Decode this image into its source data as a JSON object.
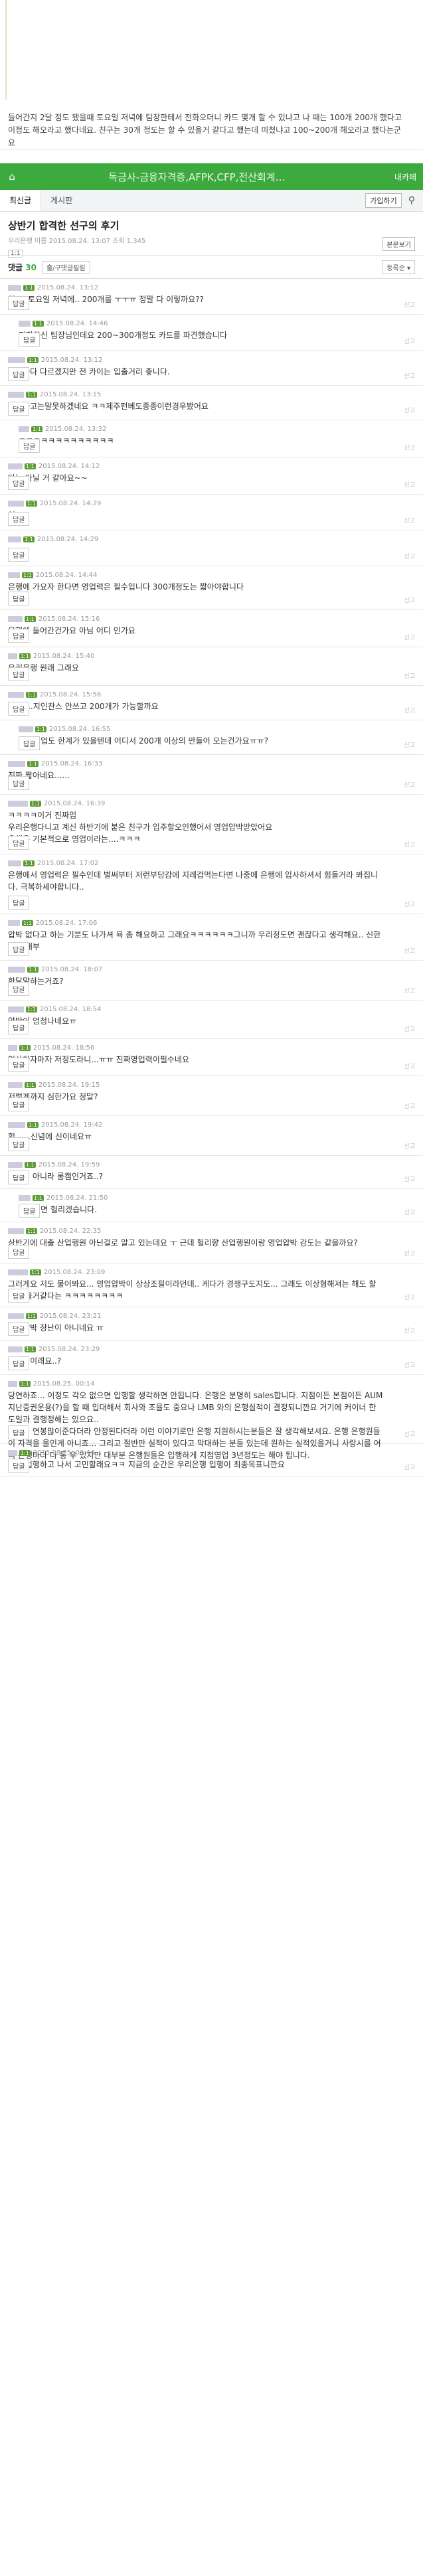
{
  "intro_text": "들어간지 2달 정도 됐을때 토요일 저녁에 팀장한테서 전화오더니 카드 몇개 할 수 있냐고 나 때는 100개 200개 했다고 이정도 해오라고 했다네요. 친구는 30개 정도는 할 수 있을거 같다고 했는데 미쳤냐고 100~200개 해오라고 했다는군요",
  "header": {
    "home_icon": "⌂",
    "title": "독금사-금융자격증,AFPK,CFP,전산회계…",
    "mycafe": "내카페"
  },
  "subnav": {
    "tab_new": "최신글",
    "tab_board": "게시판",
    "join": "가입하기",
    "search_icon": "⚲"
  },
  "post": {
    "title": "상반기 합격한 선구의 후기",
    "meta": "우리은행 이름   2015.08.24. 13:07   조회 1,345",
    "badge": "1:1",
    "orig_button": "본문보기"
  },
  "comment_bar": {
    "label": "댓글",
    "count": "30",
    "all": "출/구댓글필림",
    "sort": "등록순 ▾"
  },
  "reply_label": "답글",
  "report_label": "신고",
  "level_label": "1:1",
  "comments": [
    {
      "date": "2015.08.24. 13:12",
      "text": "헐 ... 토요일 저녁에.. 200개를 ㅜㅜㅠ 정말 다 이렇까요??"
    },
    {
      "date": "2015.08.24. 14:46",
      "text": "전화하신 팀장님인데요 200~300개정도 카드를 파견했습니다"
    },
    {
      "date": "2015.08.24. 13:12",
      "text": "지점마다 다르겠지만 전 카이는 입출거리 좋니다."
    },
    {
      "date": "2015.08.24. 13:15",
      "text": "아니라고는말못하겠네요 ㅋㅋ제주펀베도종종이런경우봤어요"
    },
    {
      "date": "2015.08.24. 13:32",
      "text": "ㅋㅋㅋㅋㅋㅋㅋㅋㅋㅋㅋㅋㅋ"
    },
    {
      "date": "2015.08.24. 14:12",
      "text": "다는 아닐 거 같아요~~"
    },
    {
      "date": "2015.08.24. 14:29",
      "text": "헐..."
    },
    {
      "date": "2015.08.24. 14:29",
      "text": "ㅜㅜ"
    },
    {
      "date": "2015.08.24. 14:44",
      "text": "은행에 가요자 한다면 영업력은 필수입니다 300개정도는 짧아야합니다"
    },
    {
      "date": "2015.08.24. 15:16",
      "text": "은행에 들어간건가요 아님 어디 인가요"
    },
    {
      "date": "2015.08.24. 15:40",
      "text": "우리은행 원래 그래요"
    },
    {
      "date": "2015.08.24. 15:56",
      "text": "헐.......지인찬스 안쓰고 200개가 가능할까요"
    },
    {
      "date": "2015.08.24. 16:55",
      "text": "지인영업도 한계가 있을텐데 어디서 200개 이상의 만들어 오는건가요ㅠㅠ?"
    },
    {
      "date": "2015.08.24. 16:33",
      "text": "진짜 짧아네요......"
    },
    {
      "date": "2015.08.24. 16:39",
      "text": "ㅋㅋㅋㅋ이거 진짜임\n우리은행다니고 계신 하반기에 붙은 친구가 입주할오인했어서 영업압박받았어요\n은행은 기본적으로 영업이라는....ㅋㅋㅋ"
    },
    {
      "date": "2015.08.24. 17:02",
      "text": "은행에서 영업력은 필수인데 벌써부터 저런부담감에 지레겁먹는다면 나중에 은행에 입사하셔서 힘들거라 봐집니다. 극복하세야합니다.."
    },
    {
      "date": "2015.08.24. 17:06",
      "text": "압박 없다고 하는 기분도 나가셔 욕 좀 해요하고 그래요ㅋㅋㅋㅋㅋㅋ그니까 우리정도면 괜찮다고 생각해요.. 신한 국민 대부"
    },
    {
      "date": "2015.08.24. 18:07",
      "text": "한달말하는거죠?"
    },
    {
      "date": "2015.08.24. 18:54",
      "text": "압박이 엄청나네요ㅠ"
    },
    {
      "date": "2015.08.24. 18:56",
      "text": "입사하자마자 저정도라니...ㅠㅠ 진짜영업력이필수네요"
    },
    {
      "date": "2015.08.24. 19:15",
      "text": "저렇게까지 심한가요 정말?"
    },
    {
      "date": "2015.08.24. 19:42",
      "text": "헐......신념에 신이네요ㅠ"
    },
    {
      "date": "2015.08.24. 19:59",
      "text": "헐리거 아니라 롱캠인거죠..?"
    },
    {
      "date": "2015.08.24. 21:50",
      "text": "상반기면 헐리겠습니다."
    },
    {
      "date": "2015.08.24. 22:35",
      "text": "상반기에 대출 산업행원 아닌걸로 알고 있는데요 ㅜ 근데 헐리향 산업행원이랑 영업압박 강도는 같을까요?"
    },
    {
      "date": "2015.08.24. 23:09",
      "text": "그러게요 저도 물어봐요... 영업압박이 상상조필이라던데.. 케다가 경쟁구도지도... 그래도 이상형해져는 해도 할 수 있을거같다는 ㅋㅋㅋㅋㅋㅋㅋㅋ"
    },
    {
      "date": "2015.08.24. 23:21",
      "text": "영업압박 장난이 아니네요 ㅠ"
    },
    {
      "date": "2015.08.24. 23:29",
      "text": "은행이이래요..?"
    },
    {
      "date": "2015.08.25. 00:14",
      "text": "당연하죠... 이정도 각오 없으면 입행할 생각하면 안됩니다. 은행은 분명히 sales합니다. 지점이든 본점이든 AUM지난증권운용(?)을 할 때 입대해서 회사와 조율도 중요나 LMB 와의 은행실적이 결정되니깐요 거기에 커이너 한도일과 결행정해는 있으요..\n은행이 연봉많이준다더라 안정된다더라 이런 이야기로만 은행 지원하시는분들은 잘 생각해보셔요. 은행 은행원들이 자격을 올인게 아니죠... 그리고 절반만 실적이 있다고 막대하는 분들 있는데 원하는 실적있을거니 사랑시를 어디 은행마다 다 통 우 있지만 대부분 은행원들은 입행하게 지점영업 3년정도는 해야 됩니다."
    },
    {
      "date": "2015.08.25. 00:44",
      "text": "그건 입행하고 나서 고민할래요ㅋㅋ 지금의 순간은 우리은행 입행이 최종목표니깐요"
    }
  ]
}
